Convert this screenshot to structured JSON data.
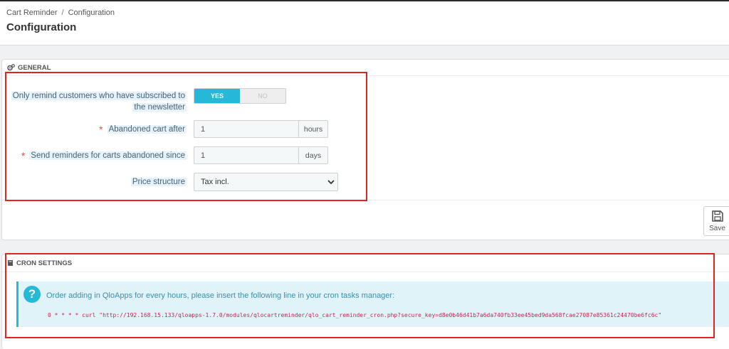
{
  "breadcrumb": {
    "parent": "Cart Reminder",
    "separator": "/",
    "current": "Configuration"
  },
  "page_title": "Configuration",
  "general": {
    "heading": "GENERAL",
    "newsletter_label_line1": "Only remind customers who have subscribed to",
    "newsletter_label_line2": "the newsletter",
    "switch_yes": "YES",
    "switch_no": "NO",
    "switch_value": "YES",
    "abandoned_after_label": "Abandoned cart after",
    "abandoned_after_value": "1",
    "abandoned_after_unit": "hours",
    "reminders_since_label": "Send reminders for carts abandoned since",
    "reminders_since_value": "1",
    "reminders_since_unit": "days",
    "price_structure_label": "Price structure",
    "price_structure_value": "Tax incl.",
    "required_marker": "*",
    "save_label": "Save"
  },
  "cron": {
    "heading": "CRON SETTINGS",
    "icon_glyph": "?",
    "message": "Order adding in QloApps for every hours, please insert the following line in your cron tasks manager:",
    "command": "0 * * * * curl \"http://192.168.15.133/qloapps-1.7.0/modules/qlocartreminder/qlo_cart_reminder_cron.php?secure_key=d8e0b46d41b7a6da740fb33ee45bed9da568fcae27087e85361c24470be6fc6c\""
  },
  "colors": {
    "accent": "#25b9d7",
    "required": "#d9534f",
    "annotation": "#e02424",
    "code": "#c7254e"
  }
}
